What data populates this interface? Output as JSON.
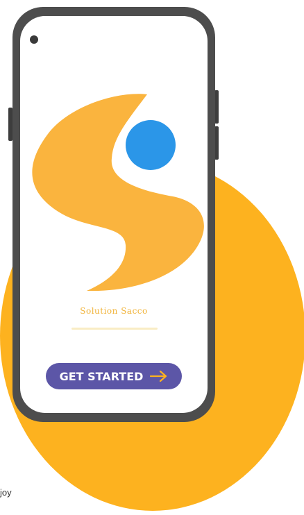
{
  "colors": {
    "background_circle": "#FDB21F",
    "logo_orange": "#FAB43E",
    "logo_blue": "#2B96E8",
    "button": "#5C56A7",
    "button_arrow": "#FDB21F",
    "phone_frame": "#4D4D4D"
  },
  "app": {
    "brand_name": "Solution Sacco",
    "logo_icon": "solution-sacco-s-logo"
  },
  "button": {
    "label": "GET STARTED",
    "icon": "arrow-right-icon"
  },
  "caption": {
    "text": "joy"
  }
}
